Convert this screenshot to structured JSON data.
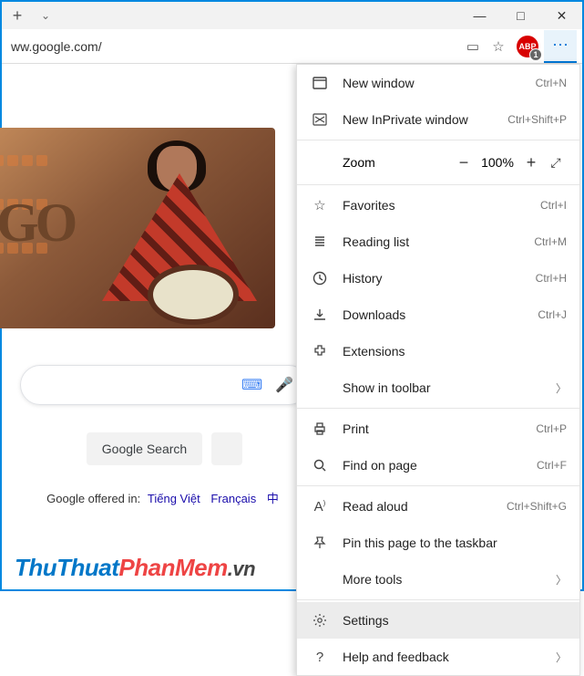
{
  "titlebar": {
    "minimize": "—",
    "maximize": "□",
    "close": "✕"
  },
  "address": {
    "url": "ww.google.com/",
    "abp_label": "ABP",
    "abp_count": "1"
  },
  "page": {
    "doodle_go": "GO",
    "search_btn": "Google Search",
    "offered_prefix": "Google offered in:",
    "lang1": "Tiếng Việt",
    "lang2": "Français",
    "lang3": "中"
  },
  "menu": {
    "new_window": "New window",
    "new_window_sc": "Ctrl+N",
    "new_inprivate": "New InPrivate window",
    "new_inprivate_sc": "Ctrl+Shift+P",
    "zoom_label": "Zoom",
    "zoom_value": "100%",
    "favorites": "Favorites",
    "favorites_sc": "Ctrl+I",
    "reading_list": "Reading list",
    "reading_list_sc": "Ctrl+M",
    "history": "History",
    "history_sc": "Ctrl+H",
    "downloads": "Downloads",
    "downloads_sc": "Ctrl+J",
    "extensions": "Extensions",
    "show_toolbar": "Show in toolbar",
    "print": "Print",
    "print_sc": "Ctrl+P",
    "find": "Find on page",
    "find_sc": "Ctrl+F",
    "read_aloud": "Read aloud",
    "read_aloud_sc": "Ctrl+Shift+G",
    "pin": "Pin this page to the taskbar",
    "more_tools": "More tools",
    "settings": "Settings",
    "help": "Help and feedback"
  },
  "watermark": {
    "p1": "ThuThuat",
    "p2": "PhanMem",
    "p3": ".vn"
  }
}
